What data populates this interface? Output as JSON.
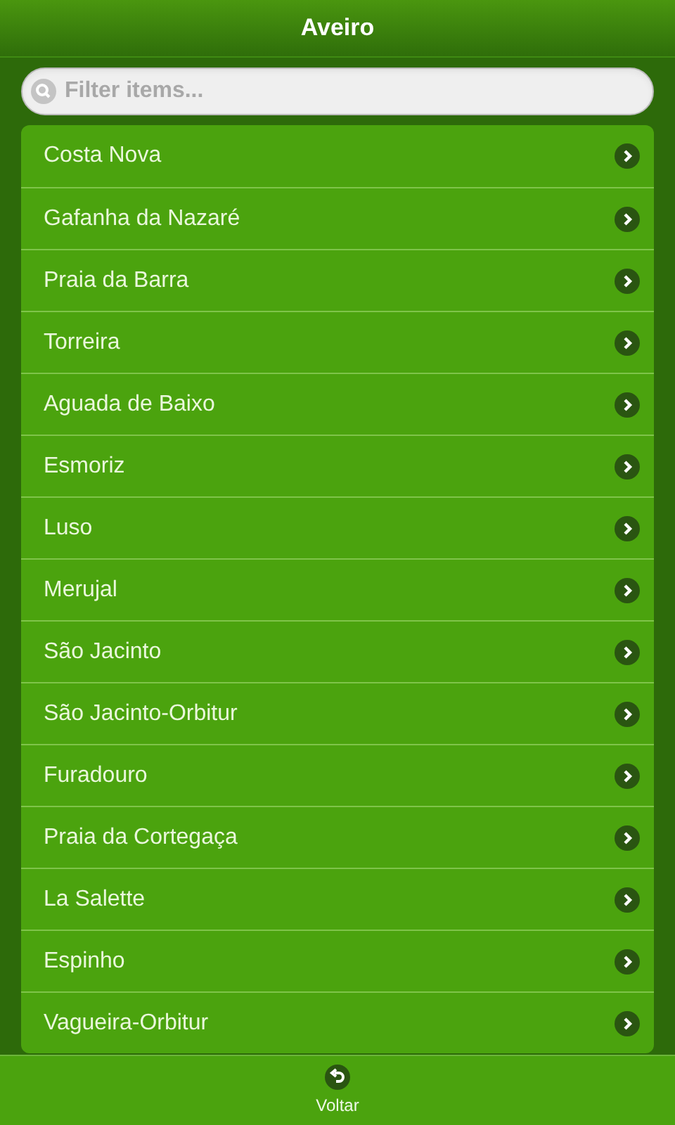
{
  "header": {
    "title": "Aveiro"
  },
  "search": {
    "placeholder": "Filter items..."
  },
  "items": [
    {
      "label": "Costa Nova"
    },
    {
      "label": "Gafanha da Nazaré"
    },
    {
      "label": "Praia da Barra"
    },
    {
      "label": "Torreira"
    },
    {
      "label": "Aguada de Baixo"
    },
    {
      "label": "Esmoriz"
    },
    {
      "label": "Luso"
    },
    {
      "label": "Merujal"
    },
    {
      "label": "São Jacinto"
    },
    {
      "label": "São Jacinto-Orbitur"
    },
    {
      "label": "Furadouro"
    },
    {
      "label": "Praia da Cortegaça"
    },
    {
      "label": "La Salette"
    },
    {
      "label": "Espinho"
    },
    {
      "label": "Vagueira-Orbitur"
    }
  ],
  "footer": {
    "button": "Voltar"
  }
}
